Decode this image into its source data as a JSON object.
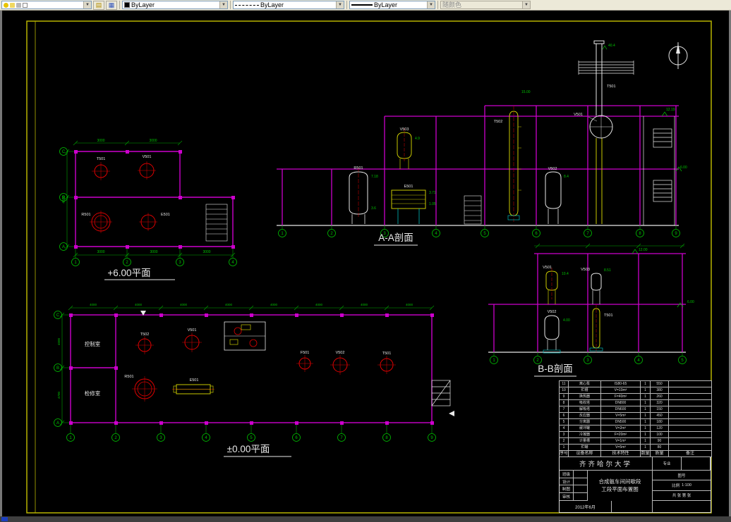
{
  "toolbar": {
    "layer_value": "",
    "color_value": "ByLayer",
    "linetype_value": "ByLayer",
    "lineweight_value": "ByLayer",
    "plotstyle_value": "随颜色"
  },
  "plan6": {
    "label": "+6.00平面",
    "cols": [
      "1",
      "2",
      "3",
      "4"
    ],
    "rows": [
      "C",
      "B",
      "A"
    ],
    "dims_top": [
      "3000",
      "3000"
    ],
    "dims_bottom": [
      "3000",
      "3000",
      "3000"
    ],
    "dim_left": "4500",
    "tags": [
      "T501",
      "V501",
      "R501",
      "E501"
    ]
  },
  "sectionA": {
    "label": "A-A剖面",
    "cols": [
      "1",
      "2",
      "3",
      "4",
      "5",
      "6",
      "7",
      "8",
      "9"
    ],
    "tags": [
      "R501",
      "E501",
      "V503",
      "T502",
      "V502",
      "V501",
      "T501"
    ],
    "elevs": {
      "top": "40.4",
      "t502": "15.00",
      "right_up": "12.19",
      "right_low": "6.00",
      "v502": "8.4",
      "e1": "3.71",
      "e2": "1.05",
      "r1": "7.18",
      "r2": "3.6",
      "v503": "4.9"
    }
  },
  "sectionB": {
    "label": "B-B剖面",
    "cols": [
      "1",
      "2",
      "3",
      "4",
      "5"
    ],
    "tags": [
      "V501",
      "V503",
      "V502",
      "T501"
    ],
    "elevs": {
      "top": "12.00",
      "mid": "6.00",
      "v501": "10.4",
      "v503": "8.51",
      "v502": "4.00"
    }
  },
  "plan0": {
    "label": "±0.00平面",
    "cols": [
      "1",
      "2",
      "3",
      "4",
      "5",
      "6",
      "7",
      "8",
      "9"
    ],
    "rows": [
      "C",
      "B",
      "A"
    ],
    "rooms": [
      "控制室",
      "检修室"
    ],
    "dims_top": [
      "4000",
      "4000",
      "4000",
      "4000",
      "4000",
      "4000",
      "4000",
      "4000"
    ],
    "dims_left": [
      "4500",
      "4700"
    ],
    "tags": [
      "T502",
      "V501",
      "R501",
      "E501",
      "F501",
      "V502",
      "T501"
    ]
  },
  "equipment_table": {
    "headers": [
      "序号",
      "设备名称",
      "技术特性",
      "数量",
      "质量",
      "备注"
    ],
    "rows": [
      {
        "no": "11",
        "name": "离心泵",
        "spec": "IS80-65",
        "qty": "1",
        "wt": "550",
        "note": ""
      },
      {
        "no": "10",
        "name": "贮槽",
        "spec": "V=10m³",
        "qty": "1",
        "wt": "380",
        "note": ""
      },
      {
        "no": "9",
        "name": "换热器",
        "spec": "F=40m²",
        "qty": "1",
        "wt": "260",
        "note": ""
      },
      {
        "no": "8",
        "name": "吸收塔",
        "spec": "DN800",
        "qty": "1",
        "wt": "320",
        "note": ""
      },
      {
        "no": "7",
        "name": "解吸塔",
        "spec": "DN600",
        "qty": "1",
        "wt": "150",
        "note": ""
      },
      {
        "no": "6",
        "name": "反应器",
        "spec": "V=5m³",
        "qty": "1",
        "wt": "450",
        "note": ""
      },
      {
        "no": "5",
        "name": "分离器",
        "spec": "DN500",
        "qty": "1",
        "wt": "180",
        "note": ""
      },
      {
        "no": "4",
        "name": "缓冲罐",
        "spec": "V=2m³",
        "qty": "1",
        "wt": "120",
        "note": ""
      },
      {
        "no": "3",
        "name": "冷凝器",
        "spec": "F=20m²",
        "qty": "1",
        "wt": "100",
        "note": ""
      },
      {
        "no": "2",
        "name": "计量槽",
        "spec": "V=1m³",
        "qty": "1",
        "wt": "90",
        "note": ""
      },
      {
        "no": "1",
        "name": "贮罐",
        "spec": "V=5m³",
        "qty": "1",
        "wt": "80",
        "note": ""
      }
    ]
  },
  "title_block": {
    "university": "齐齐哈尔大学",
    "title_line1": "合成氨车间间歇段",
    "title_line2": "工段平面布置图",
    "fields": [
      {
        "label": "班级"
      },
      {
        "label": "设计"
      },
      {
        "label": "制图"
      },
      {
        "label": "审核"
      }
    ],
    "major_label": "专业",
    "sheet_label": "图号",
    "scale_label": "比例",
    "scale": "1:100",
    "sheet_info": "共 张 第 张",
    "date": "2012年6月"
  }
}
